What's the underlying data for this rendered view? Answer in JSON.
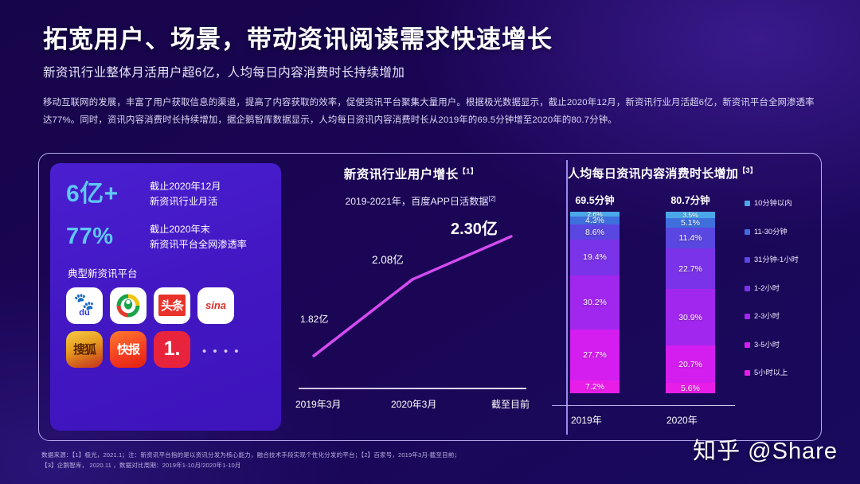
{
  "header": {
    "title": "拓宽用户、场景，带动资讯阅读需求快速增长",
    "subtitle": "新资讯行业整体月活用户超6亿，人均每日内容消费时长持续增加",
    "body": "移动互联网的发展，丰富了用户获取信息的渠道，提高了内容获取的效率，促使资讯平台聚集大量用户。根据极光数据显示，截止2020年12月，新资讯行业月活超6亿，新资讯平台全网渗透率达77%。同时，资讯内容消费时长持续增加，据企鹅智库数据显示，人均每日资讯内容消费时长从2019年的69.5分钟增至2020年的80.7分钟。"
  },
  "left_panel": {
    "stats": [
      {
        "value": "6亿+",
        "line1": "截止2020年12月",
        "line2": "新资讯行业月活"
      },
      {
        "value": "77%",
        "line1": "截止2020年末",
        "line2": "新资讯平台全网渗透率"
      }
    ],
    "platforms_label": "典型新资讯平台",
    "apps": [
      {
        "name": "baidu",
        "label": "du"
      },
      {
        "name": "tencent-news",
        "label": ""
      },
      {
        "name": "toutiao",
        "label": "头条"
      },
      {
        "name": "sina",
        "label": "sina"
      },
      {
        "name": "sohu",
        "label": "搜狐"
      },
      {
        "name": "kuaibao",
        "label": "快报"
      },
      {
        "name": "yidianzixun",
        "label": "1."
      }
    ],
    "more_dots": "• • • •"
  },
  "mid_chart": {
    "title": "新资讯行业用户增长",
    "title_sup": "【1】",
    "subtitle": "2019-2021年，百度APP日活数据",
    "subtitle_sup": "[2]"
  },
  "right_chart": {
    "title": "人均每日资讯内容消费时长增加",
    "title_sup": "【3】"
  },
  "footnote": {
    "line1": "数据来源：【1】极光，2021.1；注：新资讯平台指的是以资讯分发为核心能力，融合技术手段实现个性化分发的平台；【2】百家号，2019年3月-截至目前；",
    "line2": "【3】企鹅智库， 2020.11 ，数据对比周期：2019年1-10月/2020年1-10月"
  },
  "watermark": "知乎 @Share",
  "colors": {
    "accent_cyan": "#5ec8f5",
    "line_magenta": "#d44bf0",
    "panel_purple": "#4318c4",
    "background": "#1a0555"
  },
  "chart_data": [
    {
      "type": "line",
      "title": "新资讯行业用户增长【1】",
      "subtitle": "2019-2021年，百度APP日活数据 [2]",
      "x": [
        "2019年3月",
        "2020年3月",
        "截至目前"
      ],
      "values": [
        1.82,
        2.08,
        2.3
      ],
      "point_labels": [
        "1.82亿",
        "2.08亿",
        "2.30亿"
      ],
      "unit": "亿",
      "ylabel": "",
      "xlabel": "",
      "grid": false,
      "legend": "none",
      "series_color": "#d44bf0"
    },
    {
      "type": "bar",
      "subtype": "stacked-100",
      "title": "人均每日资讯内容消费时长增加【3】",
      "categories": [
        "2019年",
        "2020年"
      ],
      "category_headers": [
        "69.5分钟",
        "80.7分钟"
      ],
      "legend_position": "right",
      "series": [
        {
          "name": "10分钟以内",
          "color": "#4aa8e8",
          "values": [
            2.6,
            3.5
          ]
        },
        {
          "name": "11-30分钟",
          "color": "#3f6fdd",
          "values": [
            4.3,
            5.1
          ]
        },
        {
          "name": "31分钟-1小时",
          "color": "#5a46e0",
          "values": [
            8.6,
            11.4
          ]
        },
        {
          "name": "1-2小时",
          "color": "#7a33e8",
          "values": [
            19.4,
            22.7
          ]
        },
        {
          "name": "2-3小时",
          "color": "#a227ee",
          "values": [
            30.2,
            30.9
          ]
        },
        {
          "name": "3-5小时",
          "color": "#d41ef0",
          "values": [
            27.7,
            20.7
          ]
        },
        {
          "name": "5小时以上",
          "color": "#e81ee8",
          "values": [
            7.2,
            5.6
          ]
        }
      ],
      "legend_order_top_to_bottom": [
        "10分钟以内",
        "11-30分钟",
        "31分钟-1小时",
        "1-2小时",
        "2-3小时",
        "3-5小时",
        "5小时以上"
      ],
      "value_suffix": "%",
      "ylim": [
        0,
        100
      ]
    }
  ]
}
